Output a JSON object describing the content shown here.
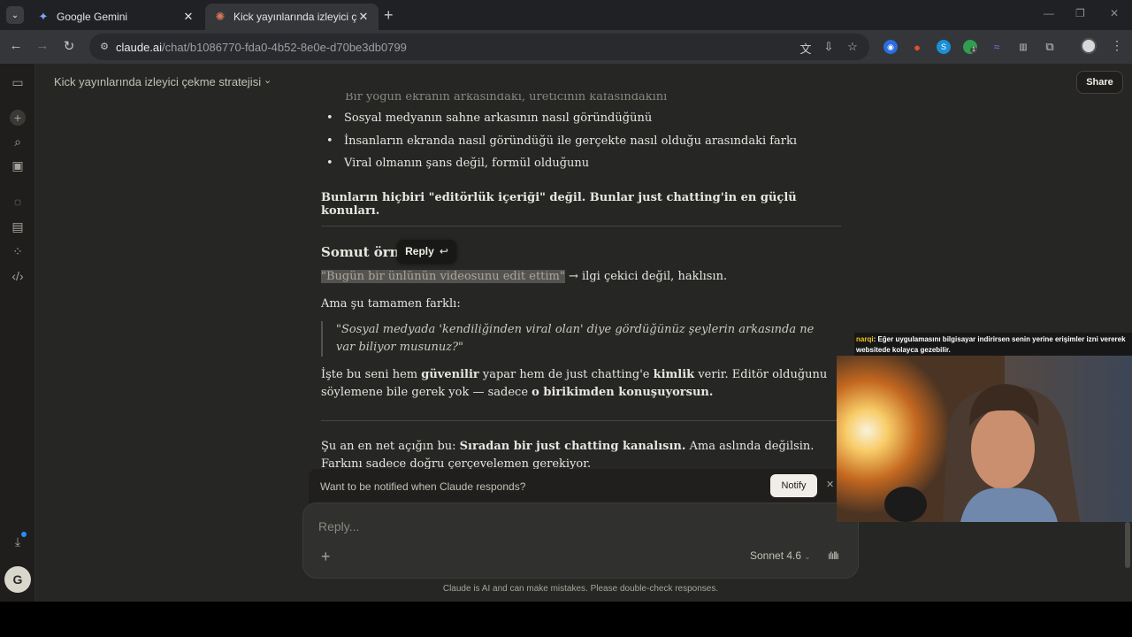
{
  "browser": {
    "tabs": [
      {
        "title": "Google Gemini",
        "active": false
      },
      {
        "title": "Kick yayınlarında izleyici çekme",
        "active": true
      }
    ],
    "url_host": "claude.ai",
    "url_path": "/chat/b1086770-fda0-4b52-8e0e-d70be3db0799",
    "extension_badge": "1"
  },
  "conversation": {
    "title": "Kick yayınlarında izleyici çekme stratejisi",
    "share_label": "Share"
  },
  "message": {
    "partial_line": "Bir yoğun ekranın arkasındaki, üreticinin kafasındakini",
    "bullets": [
      "Sosyal medyanın sahne arkasının nasıl göründüğünü",
      "İnsanların ekranda nasıl göründüğü ile gerçekte nasıl olduğu arasındaki farkı",
      "Viral olmanın şans değil, formül olduğunu"
    ],
    "bold_paragraph": "Bunların hiçbiri \"editörlük içeriği\" değil. Bunlar just chatting'in en güçlü konuları.",
    "heading": "Somut örnek",
    "reply_popup": "Reply",
    "quote_highlight": "\"Bugün bir ünlünün videosunu edit ettim\"",
    "quote_rest": " → ilgi çekici değil, haklısın.",
    "p2": "Ama şu tamamen farklı:",
    "blockquote": "\"Sosyal medyada 'kendiliğinden viral olan' diye gördüğünüz şeylerin arkasında ne var biliyor musunuz?\"",
    "p3_a": "İşte bu seni hem ",
    "p3_b": "güvenilir",
    "p3_c": " yapar hem de just chatting'e ",
    "p3_d": "kimlik",
    "p3_e": " verir. Editör olduğunu söylemene bile gerek yok — sadece ",
    "p3_f": "o birikimden konuşuyorsun.",
    "p4_a": "Şu an en net açığın bu: ",
    "p4_b": "Sıradan bir just chatting kanalısın.",
    "p4_c": " Ama aslında değilsin. Farkını sadece doğru çerçevelemen gerekiyor."
  },
  "notify": {
    "text": "Want to be notified when Claude responds?",
    "button": "Notify"
  },
  "composer": {
    "placeholder": "Reply...",
    "model": "Sonnet 4.6"
  },
  "disclaimer": "Claude is AI and can make mistakes. Please double-check responses.",
  "sidebar": {
    "avatar_initial": "G"
  },
  "stream_chat": {
    "user": "narqi",
    "message": ": Eğer uygulamasını bilgisayar indirirsen senin yerine erişimler izni vererek websitede kolayca gezebilir."
  }
}
